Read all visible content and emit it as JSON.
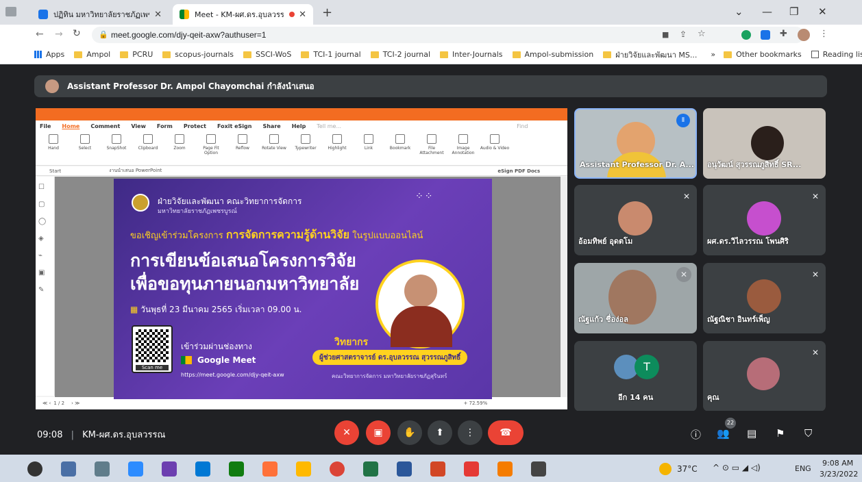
{
  "browser": {
    "tabs": [
      {
        "title": "ปฏิทิน มหาวิทยาลัยราชภัฏเพชรบูรณ์"
      },
      {
        "title": "Meet - KM-ผศ.ดร.อุบลวรรณ"
      }
    ],
    "url": "meet.google.com/djy-qeit-axw?authuser=1",
    "bookmarks": [
      "Apps",
      "Ampol",
      "PCRU",
      "scopus-journals",
      "SSCI-WoS",
      "TCI-1 journal",
      "TCI-2 journal",
      "Inter-Journals",
      "Ampol-submission",
      "ฝ่ายวิจัยและพัฒนา MS..."
    ],
    "other_bookmarks": "Other bookmarks",
    "reading_list": "Reading list"
  },
  "meet": {
    "presenting_banner": "Assistant Professor Dr. Ampol Chayomchai กำลังนำเสนอ",
    "participants": [
      {
        "name": "Assistant Professor Dr. A..."
      },
      {
        "name": "อนุวัฒน์ สุวรรณภูสิทธิ์ SR..."
      },
      {
        "name": "อ้อมทิพย์ อุดตโม"
      },
      {
        "name": "ผศ.ดร.วิไลวรรณ โพนศิริ"
      },
      {
        "name": "ณัฐแก้ว ชื่อง่อล"
      },
      {
        "name": "ณัฐณิชา อินทร์เพ็ญ"
      },
      {
        "name": "อีก 14 คน"
      },
      {
        "name": "คุณ"
      }
    ],
    "avatar_letter": "T",
    "meeting_time": "09:08",
    "meeting_title": "KM-ผศ.ดร.อุบลวรรณ",
    "people_count": "22"
  },
  "foxit": {
    "menu": [
      "File",
      "Home",
      "Comment",
      "View",
      "Form",
      "Protect",
      "Foxit eSign",
      "Share",
      "Help"
    ],
    "tell_me": "Tell me...",
    "find": "Find",
    "tools": [
      "Hand",
      "Select",
      "SnapShot",
      "Clipboard",
      "Zoom",
      "Page Fit Option",
      "Reflow",
      "Rotate View",
      "Typewriter",
      "Highlight",
      "Link",
      "Bookmark",
      "File Attachment",
      "Image Annotation",
      "Audio & Video"
    ],
    "doc_tabs": [
      "Start",
      "งานนำเสนอ PowerPoint"
    ],
    "esign": "eSign PDF Docs",
    "page_indicator": "1 / 2",
    "zoom": "+ 72.59%"
  },
  "slide": {
    "org_line1": "ฝ่ายวิจัยและพัฒนา คณะวิทยาการจัดการ",
    "org_line2": "มหาวิทยาลัยราชภัฏเพชรบูรณ์",
    "invite_prefix": "ขอเชิญเข้าร่วมโครงการ",
    "invite_highlight": "การจัดการความรู้ด้านวิจัย",
    "invite_suffix": "ในรูปแบบออนไลน์",
    "headline1": "การเขียนข้อเสนอโครงการวิจัย",
    "headline2": "เพื่อขอทุนภายนอกมหาวิทยาลัย",
    "date": "วันพุธที่ 23 มีนาคม 2565   เริ่มเวลา 09.00 น.",
    "join_via": "เข้าร่วมผ่านช่องทาง",
    "platform": "Google Meet",
    "link": "https://meet.google.com/djy-qeit-axw",
    "scan": "Scan me",
    "speaker_label": "วิทยากร",
    "speaker_name": "ผู้ช่วยศาสตราจารย์ ดร.อุบลวรรณ สุวรรณภูสิทธิ์",
    "speaker_affil": "คณะวิทยาการจัดการ มหาวิทยาลัยราชภัฏสุรินทร์"
  },
  "taskbar": {
    "temperature": "37°C",
    "lang": "ENG",
    "time": "9:08 AM",
    "date": "3/23/2022"
  },
  "colors": {
    "meet_red": "#ea4335",
    "meet_bg": "#202124",
    "tile_bg": "#3c4043",
    "foxit_orange": "#f36c21",
    "slide_purple": "#5a36a8",
    "highlight_yellow": "#ffd21f"
  }
}
